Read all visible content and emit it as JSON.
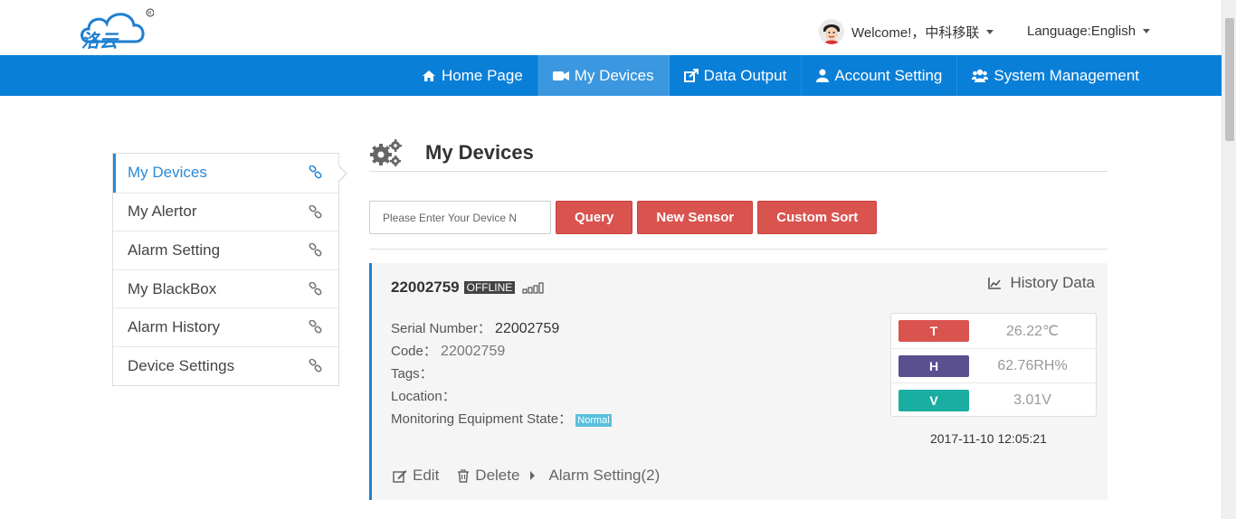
{
  "header": {
    "logo_name": "cloud-logo",
    "welcome_label": "Welcome!，中科移联",
    "language_label": "Language:English"
  },
  "nav": {
    "items": [
      {
        "label": "Home Page",
        "icon": "home-icon"
      },
      {
        "label": "My Devices",
        "icon": "video-camera-icon",
        "active": true
      },
      {
        "label": "Data Output",
        "icon": "export-icon"
      },
      {
        "label": "Account Setting",
        "icon": "user-icon"
      },
      {
        "label": "System Management",
        "icon": "users-icon"
      }
    ],
    "color": "#0a7fd8",
    "active_color": "#3a97e0"
  },
  "sidebar": {
    "items": [
      {
        "label": "My Devices",
        "active": true
      },
      {
        "label": "My Alertor"
      },
      {
        "label": "Alarm Setting"
      },
      {
        "label": "My BlackBox"
      },
      {
        "label": "Alarm History"
      },
      {
        "label": "Device Settings"
      }
    ],
    "icon": "link-icon"
  },
  "main": {
    "title": "My Devices",
    "title_icon": "gears-icon",
    "search": {
      "placeholder": "Please Enter Your Device N",
      "value": ""
    },
    "buttons": {
      "query": "Query",
      "new_sensor": "New Sensor",
      "custom_sort": "Custom Sort"
    },
    "button_color": "#d9534f"
  },
  "device": {
    "id": "22002759",
    "status_badge": "OFFLINE",
    "history_label": "History Data",
    "serial_label": "Serial Number：",
    "serial_value": "22002759",
    "code_label": "Code：",
    "code_value": "22002759",
    "tags_label": "Tags：",
    "location_label": "Location：",
    "state_label": "Monitoring Equipment State：",
    "state_value": "Normal",
    "readings": [
      {
        "tag": "T",
        "value": "26.22℃",
        "color": "#d9534f"
      },
      {
        "tag": "H",
        "value": "62.76RH%",
        "color": "#5a4f8f"
      },
      {
        "tag": "V",
        "value": "3.01V",
        "color": "#1aada2"
      }
    ],
    "timestamp": "2017-11-10 12:05:21",
    "actions": {
      "edit": "Edit",
      "delete": "Delete",
      "alarm_setting": "Alarm Setting(2)"
    }
  }
}
